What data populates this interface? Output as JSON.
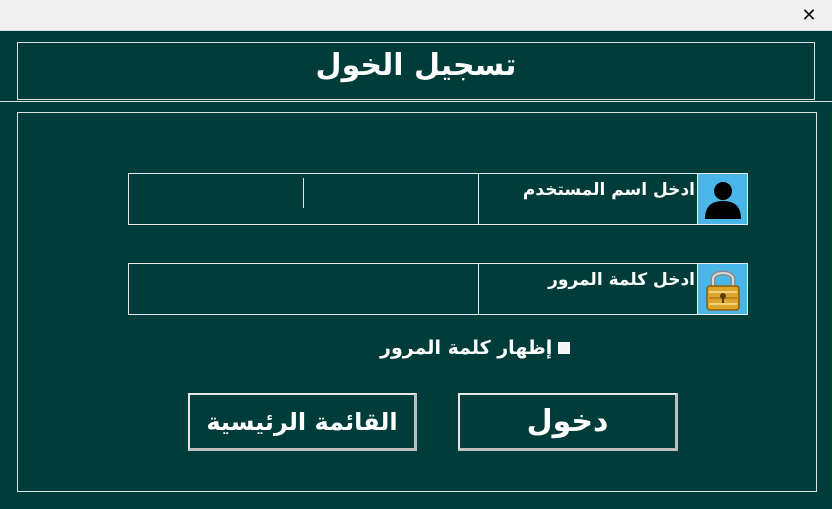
{
  "window": {
    "close_glyph": "✕"
  },
  "header": {
    "title": "تسجيل الخول"
  },
  "form": {
    "username": {
      "label": "ادخل اسم المستخدم",
      "value": "",
      "icon": "user-icon"
    },
    "password": {
      "label": "ادخل كلمة المرور",
      "value": "",
      "icon": "padlock-icon"
    },
    "show_password": {
      "label": "إظهار كلمة المرور",
      "checked": false
    }
  },
  "buttons": {
    "login_label": "دخول",
    "main_menu_label": "القائمة الرئيسية"
  },
  "colors": {
    "background": "#003d3a",
    "icon_background": "#4bb7e8",
    "border": "#e6ecea",
    "text": "#ffffff"
  }
}
